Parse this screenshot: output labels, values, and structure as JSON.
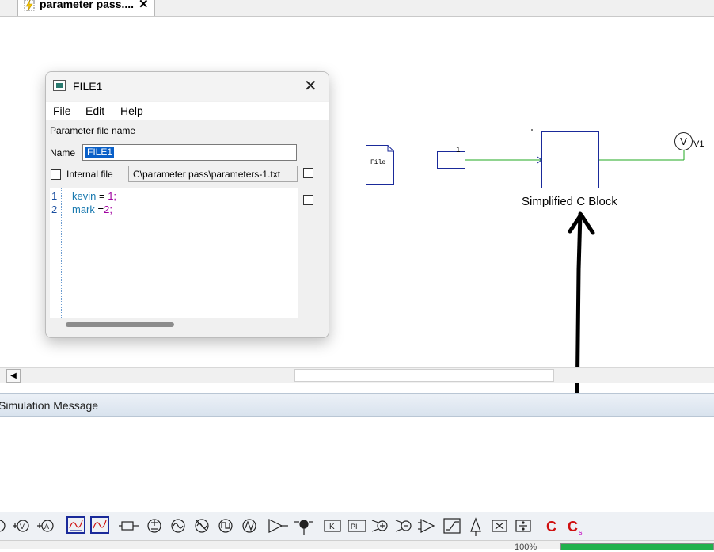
{
  "tabs": [
    {
      "label": "parameter pass...."
    }
  ],
  "dialog": {
    "title": "FILE1",
    "menu": [
      "File",
      "Edit",
      "Help"
    ],
    "param_file_label": "Parameter file name",
    "name_label": "Name",
    "name_value": "FILE1",
    "internal_file_label": "Internal file",
    "path_value": "C\\parameter pass\\parameters-1.txt",
    "code_lines": [
      {
        "num": "1",
        "id": "kevin",
        "op": " = ",
        "val": "1",
        "end": ";"
      },
      {
        "num": "2",
        "id": "mark",
        "op": " =",
        "val": "2",
        "end": ";"
      }
    ]
  },
  "diagram": {
    "file_block_label": "File",
    "const_value": "1",
    "c_block_label": "Simplified C Block",
    "meter_symbol": "V",
    "meter_label": "V1",
    "wire_color": "#22a822",
    "block_color": "#1a2a9a"
  },
  "sim_panel": {
    "title": "Simulation Message"
  },
  "toolbar_icons": [
    "voltmeter-icon",
    "voltmeter-icon",
    "ammeter-icon",
    "scope-icon",
    "scope-2-icon",
    "resistor-icon",
    "dc-source-icon",
    "ac-source-icon",
    "sine-source-icon",
    "square-source-icon",
    "pulse-source-icon",
    "amplifier-icon",
    "probe-icon",
    "gain-icon",
    "pi-controller-icon",
    "summer-icon",
    "summer-2-icon",
    "comparator-icon",
    "limiter-icon",
    "triangle-icon",
    "multiplier-icon",
    "divider-icon",
    "c-block-icon",
    "simplified-c-block-icon"
  ],
  "status": {
    "zoom": "100%",
    "progress": 1.0
  }
}
